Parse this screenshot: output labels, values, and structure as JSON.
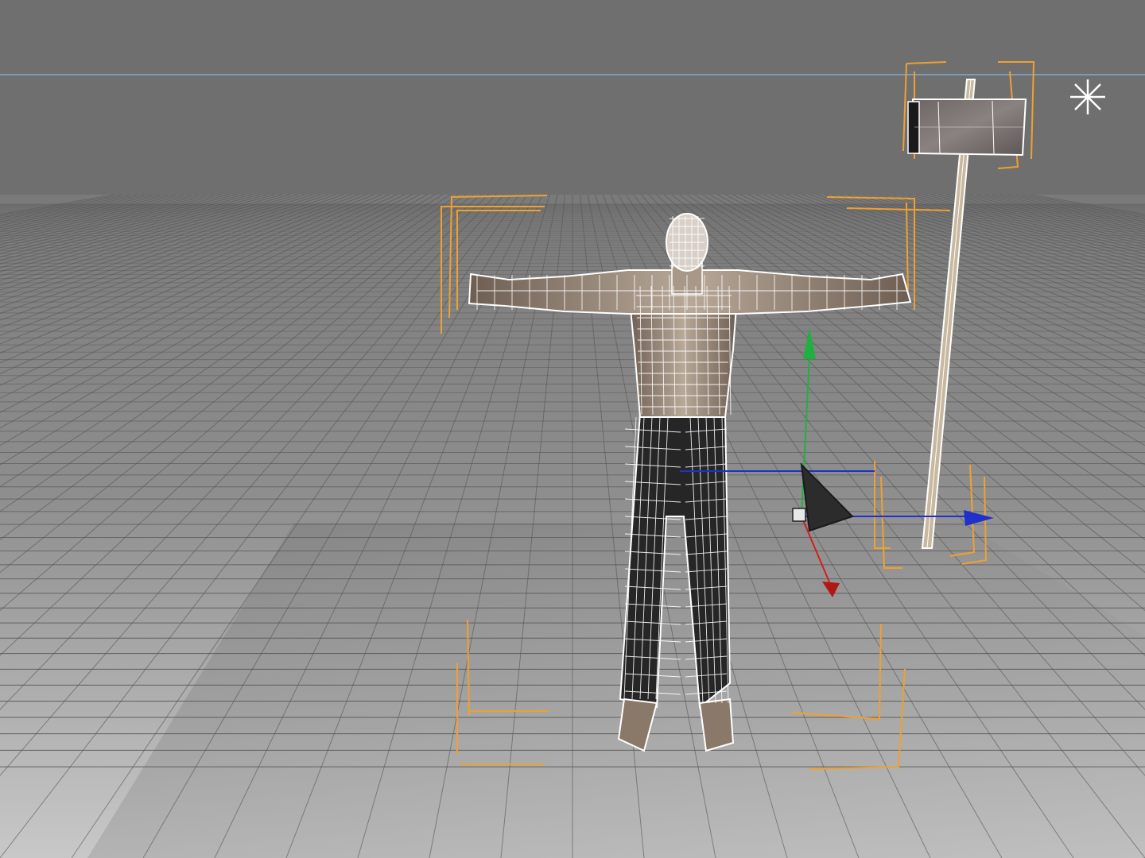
{
  "viewport": {
    "mode": "perspective",
    "shading": "smooth-shaded-with-wireframe",
    "label": ""
  },
  "colors": {
    "background_top": "#6f6f6f",
    "horizon_line": "#8aa6c8",
    "grid_far": "#7d7d7d",
    "grid_near": "#b8b8b8",
    "grid_lines": "#555555",
    "ground_shadow": "#5f5f5f",
    "selection_brackets": "#f0a030",
    "wireframe": "#ffffff",
    "skin": "#9a8878",
    "pants": "#2a2a2a",
    "gizmo_x": "#d02020",
    "gizmo_y": "#20b040",
    "gizmo_z": "#2030c8"
  },
  "objects": [
    {
      "id": "character",
      "icon": "character-mesh-icon",
      "selected": true
    },
    {
      "id": "hammer",
      "icon": "hammer-mesh-icon",
      "selected": true
    }
  ],
  "gizmo": {
    "type": "move-transform",
    "axes": [
      "x",
      "y",
      "z"
    ]
  },
  "light": {
    "icon": "point-light-icon"
  }
}
